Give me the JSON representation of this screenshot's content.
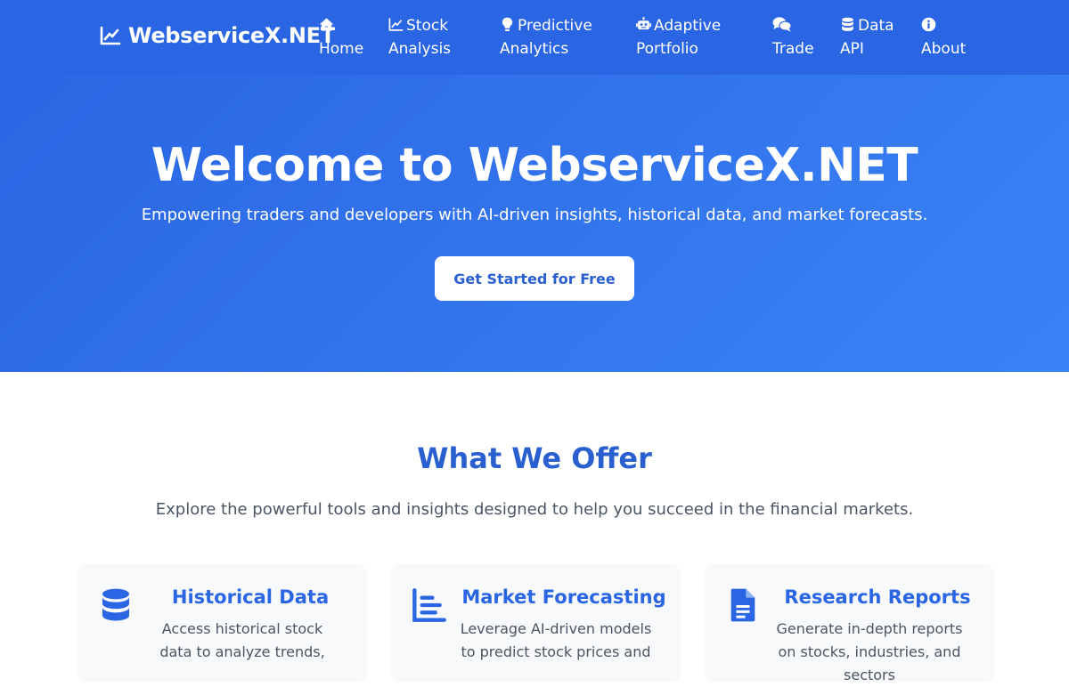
{
  "header": {
    "brand": "WebserviceX.NET",
    "nav": [
      {
        "icon": "home-icon",
        "lines": [
          "Home"
        ]
      },
      {
        "icon": "chart-line-icon",
        "lines": [
          "Stock",
          "Analysis"
        ]
      },
      {
        "icon": "lightbulb-icon",
        "lines": [
          "Predictive",
          "Analytics"
        ]
      },
      {
        "icon": "robot-icon",
        "lines": [
          "Adaptive",
          "Portfolio"
        ]
      },
      {
        "icon": "comments-icon",
        "lines": [
          "Trade"
        ]
      },
      {
        "icon": "database-icon",
        "lines": [
          "Data",
          "API"
        ]
      },
      {
        "icon": "info-circle-icon",
        "lines": [
          "About"
        ]
      }
    ]
  },
  "hero": {
    "title": "Welcome to WebserviceX.NET",
    "subtitle": "Empowering traders and developers with AI-driven insights, historical data, and market forecasts.",
    "cta": "Get Started for Free"
  },
  "offer": {
    "title": "What We Offer",
    "subtitle": "Explore the powerful tools and insights designed to help you succeed in the financial markets.",
    "cards": [
      {
        "icon": "database-icon",
        "title": "Historical Data",
        "text": "Access historical stock data to analyze trends,"
      },
      {
        "icon": "chart-bar-icon",
        "title": "Market Forecasting",
        "text": "Leverage AI-driven models to predict stock prices and"
      },
      {
        "icon": "file-alt-icon",
        "title": "Research Reports",
        "text": "Generate in-depth reports on stocks, industries, and sectors"
      }
    ]
  },
  "colors": {
    "primary": "#2a66e3",
    "hero_gradient_end": "#3b82f6",
    "heading_blue": "#2a5fd0",
    "body_text": "#4b5563",
    "card_bg": "#f8f9fb"
  }
}
